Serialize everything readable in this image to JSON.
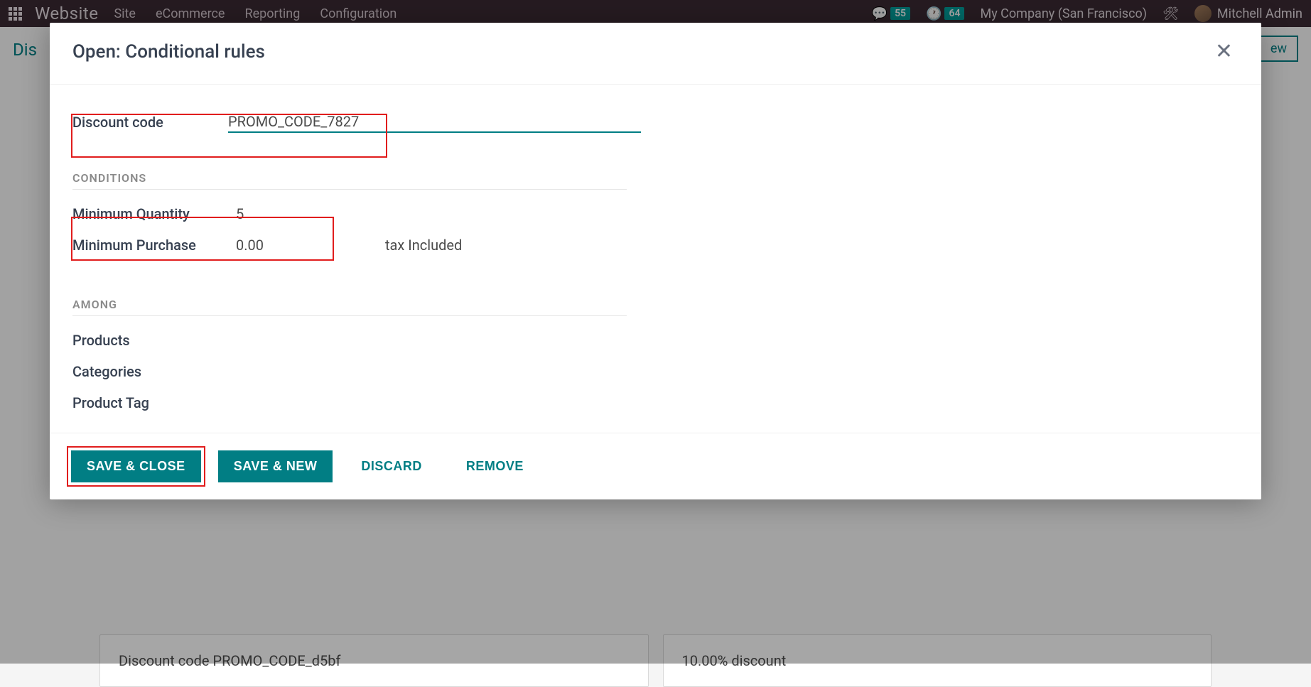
{
  "topbar": {
    "brand": "Website",
    "menu": [
      "Site",
      "eCommerce",
      "Reporting",
      "Configuration"
    ],
    "chat_badge": "55",
    "clock_badge": "64",
    "company": "My Company (San Francisco)",
    "user": "Mitchell Admin"
  },
  "page": {
    "breadcrumb": "Dis",
    "btn_label_partial": "ew",
    "row_left": "Discount code PROMO_CODE_d5bf",
    "row_right": "10.00% discount"
  },
  "modal": {
    "title": "Open: Conditional rules",
    "discount_code_label": "Discount code",
    "discount_code_value": "PROMO_CODE_7827",
    "conditions_header": "CONDITIONS",
    "min_qty_label": "Minimum Quantity",
    "min_qty_value": "5",
    "min_purchase_label": "Minimum Purchase",
    "min_purchase_value": "0.00",
    "tax_included": "tax Included",
    "among_header": "AMONG",
    "products_label": "Products",
    "categories_label": "Categories",
    "product_tag_label": "Product Tag",
    "footer": {
      "save_close": "SAVE & CLOSE",
      "save_new": "SAVE & NEW",
      "discard": "DISCARD",
      "remove": "REMOVE"
    }
  }
}
